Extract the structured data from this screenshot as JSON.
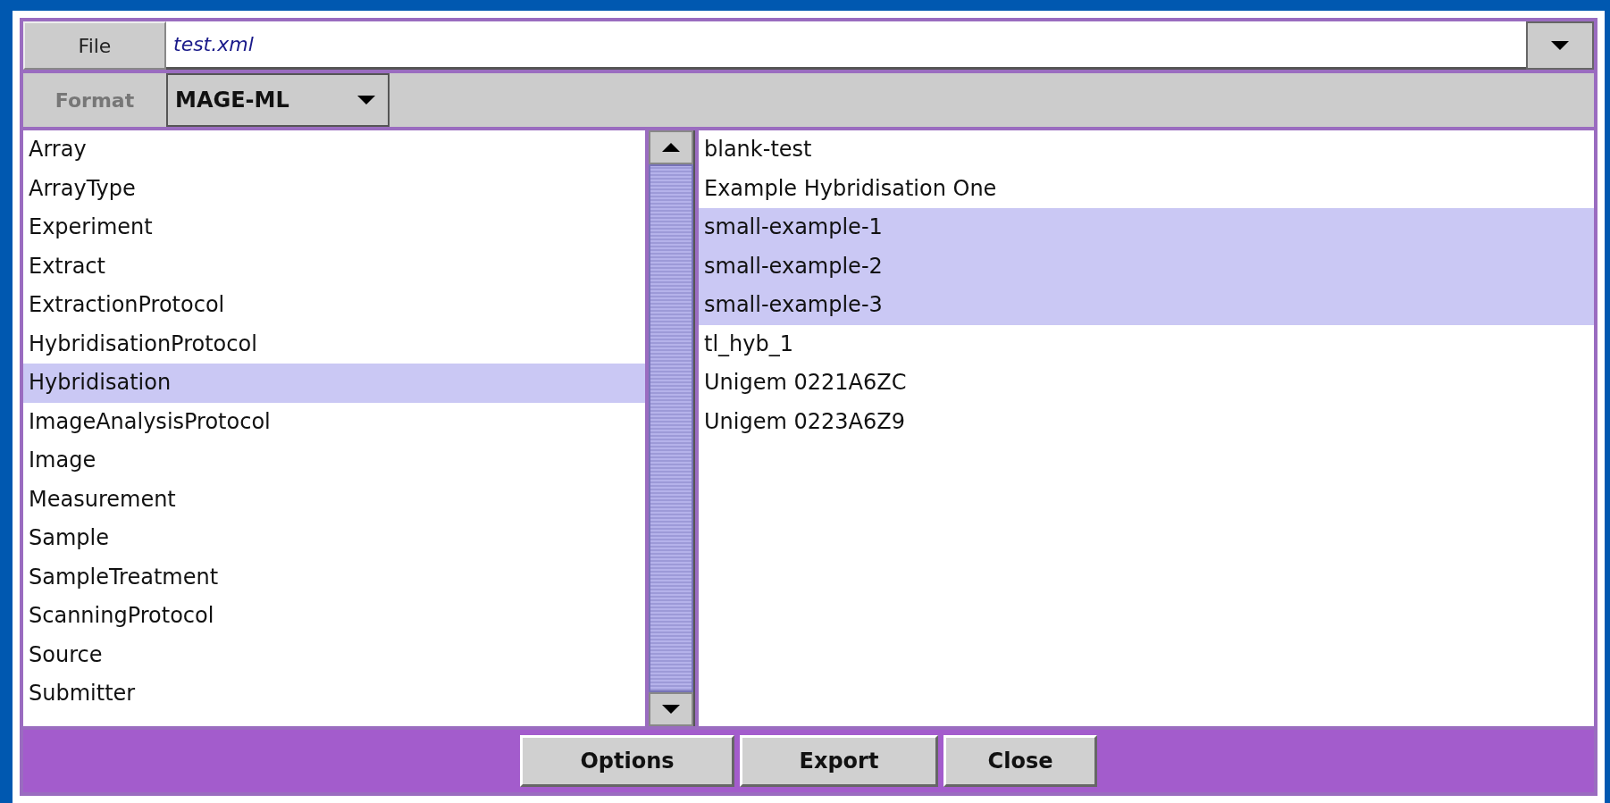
{
  "file": {
    "label": "File",
    "value": "test.xml"
  },
  "format": {
    "label": "Format",
    "value": "MAGE-ML"
  },
  "types": [
    {
      "label": "Array",
      "selected": false
    },
    {
      "label": "ArrayType",
      "selected": false
    },
    {
      "label": "Experiment",
      "selected": false
    },
    {
      "label": "Extract",
      "selected": false
    },
    {
      "label": "ExtractionProtocol",
      "selected": false
    },
    {
      "label": "HybridisationProtocol",
      "selected": false
    },
    {
      "label": "Hybridisation",
      "selected": true
    },
    {
      "label": "ImageAnalysisProtocol",
      "selected": false
    },
    {
      "label": "Image",
      "selected": false
    },
    {
      "label": "Measurement",
      "selected": false
    },
    {
      "label": "Sample",
      "selected": false
    },
    {
      "label": "SampleTreatment",
      "selected": false
    },
    {
      "label": "ScanningProtocol",
      "selected": false
    },
    {
      "label": "Source",
      "selected": false
    },
    {
      "label": "Submitter",
      "selected": false
    }
  ],
  "items": [
    {
      "label": "blank-test",
      "selected": false
    },
    {
      "label": "Example Hybridisation One",
      "selected": false
    },
    {
      "label": "small-example-1",
      "selected": true
    },
    {
      "label": "small-example-2",
      "selected": true
    },
    {
      "label": "small-example-3",
      "selected": true
    },
    {
      "label": "tl_hyb_1",
      "selected": false
    },
    {
      "label": "Unigem 0221A6ZC",
      "selected": false
    },
    {
      "label": "Unigem 0223A6Z9",
      "selected": false
    }
  ],
  "buttons": [
    "Options",
    "Export",
    "Close"
  ]
}
